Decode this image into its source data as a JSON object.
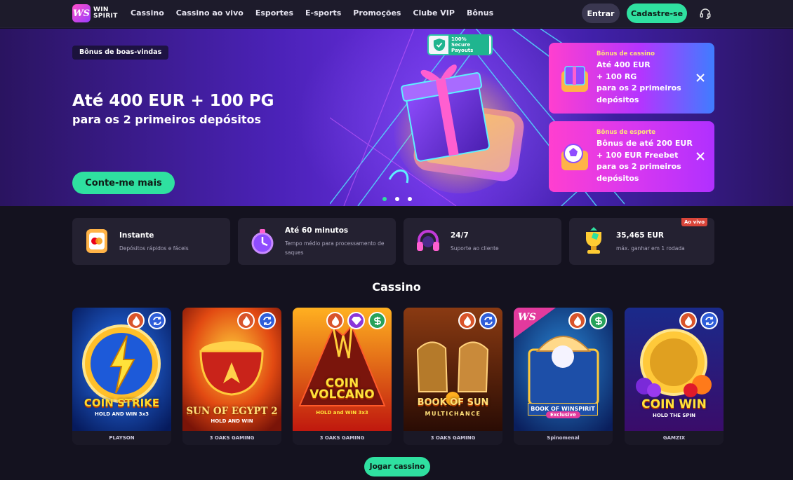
{
  "header": {
    "logo_line1": "WIN",
    "logo_line2": "SPIRIT",
    "logo_mark": "WS",
    "nav": [
      "Cassino",
      "Cassino ao vivo",
      "Esportes",
      "E-sports",
      "Promoções",
      "Clube VIP",
      "Bônus"
    ],
    "login_label": "Entrar",
    "signup_label": "Cadastre-se",
    "support_icon": "headset-icon"
  },
  "hero": {
    "tag": "Bônus de boas-vindas",
    "title": "Até 400 EUR + 100 PG",
    "subtitle": "para os 2 primeiros depósitos",
    "cta_label": "Conte-me mais",
    "secure_badge": "100% Secure Payouts",
    "slides_count": 3,
    "active_slide": 1,
    "bonus_cards": [
      {
        "label": "Bônus de cassino",
        "text": "Até 400 EUR\n+ 100 RG\npara os 2 primeiros\ndepósitos"
      },
      {
        "label": "Bônus de esporte",
        "text": "Bônus de até 200 EUR\n+ 100 EUR Freebet\npara os 2 primeiros\ndepósitos"
      }
    ]
  },
  "features": [
    {
      "title": "Instante",
      "subtitle": "Depósitos rápidos e fáceis",
      "icon": "card-icon"
    },
    {
      "title": "Até 60 minutos",
      "subtitle": "Tempo médio para processamento de saques",
      "icon": "stopwatch-icon"
    },
    {
      "title": "24/7",
      "subtitle": "Suporte ao cliente",
      "icon": "headset-icon"
    },
    {
      "title": "35,465 EUR",
      "subtitle": "máx. ganhar em 1 rodada",
      "icon": "trophy-icon",
      "live_tag": "Ao vivo"
    }
  ],
  "casino": {
    "title": "Cassino",
    "cta_label": "Jogar cassino",
    "games": [
      {
        "title": "COIN STRIKE",
        "sub": "HOLD AND WIN 3x3",
        "provider": "PLAYSON"
      },
      {
        "title": "SUN OF EGYPT 2",
        "sub": "HOLD AND WIN",
        "provider": "3 OAKS GAMING"
      },
      {
        "title": "COIN VOLCANO",
        "sub": "HOLD and WIN 3x3",
        "provider": "3 OAKS GAMING"
      },
      {
        "title": "BOOK OF SUN",
        "sub": "MULTICHANCE",
        "provider": "3 OAKS GAMING"
      },
      {
        "title": "BOOK OF WINSPIRIT",
        "sub": "Exclusive",
        "provider": "Spinomenal"
      },
      {
        "title": "COIN WIN",
        "sub": "HOLD THE SPIN",
        "provider": "GAMZIX"
      }
    ]
  },
  "colors": {
    "accent": "#2fe0a0",
    "background": "#14121f",
    "card": "#242131"
  }
}
